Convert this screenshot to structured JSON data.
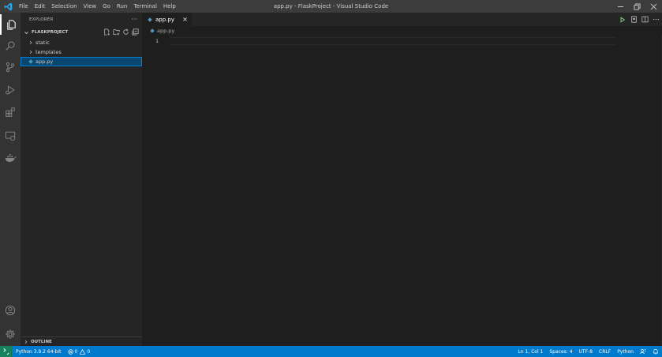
{
  "window": {
    "title": "app.py - FlaskProject - Visual Studio Code"
  },
  "menu": [
    "File",
    "Edit",
    "Selection",
    "View",
    "Go",
    "Run",
    "Terminal",
    "Help"
  ],
  "activity_bar": {
    "top": [
      "explorer-icon",
      "search-icon",
      "source-control-icon",
      "run-debug-icon",
      "extensions-icon",
      "remote-explorer-icon",
      "docker-icon"
    ],
    "bottom": [
      "account-icon",
      "settings-gear-icon"
    ]
  },
  "sidebar": {
    "header": "EXPLORER",
    "more": "···",
    "project": "FLASKPROJECT",
    "items": [
      {
        "label": "static",
        "type": "folder"
      },
      {
        "label": "templates",
        "type": "folder"
      },
      {
        "label": "app.py",
        "type": "python-file",
        "selected": true
      }
    ],
    "outline": "OUTLINE"
  },
  "tabs": [
    {
      "label": "app.py",
      "active": true
    }
  ],
  "breadcrumb": {
    "file": "app.py"
  },
  "editor": {
    "line_numbers": [
      "1"
    ]
  },
  "statusbar": {
    "interpreter": "Python 3.9.2 64-bit",
    "errors": "0",
    "warnings": "0",
    "position": "Ln 1, Col 1",
    "spaces": "Spaces: 4",
    "encoding": "UTF-8",
    "eol": "CRLF",
    "language": "Python"
  },
  "colors": {
    "accent": "#007acc",
    "python_icon": "#519aba",
    "selection": "#094771",
    "run_green": "#89d185"
  }
}
